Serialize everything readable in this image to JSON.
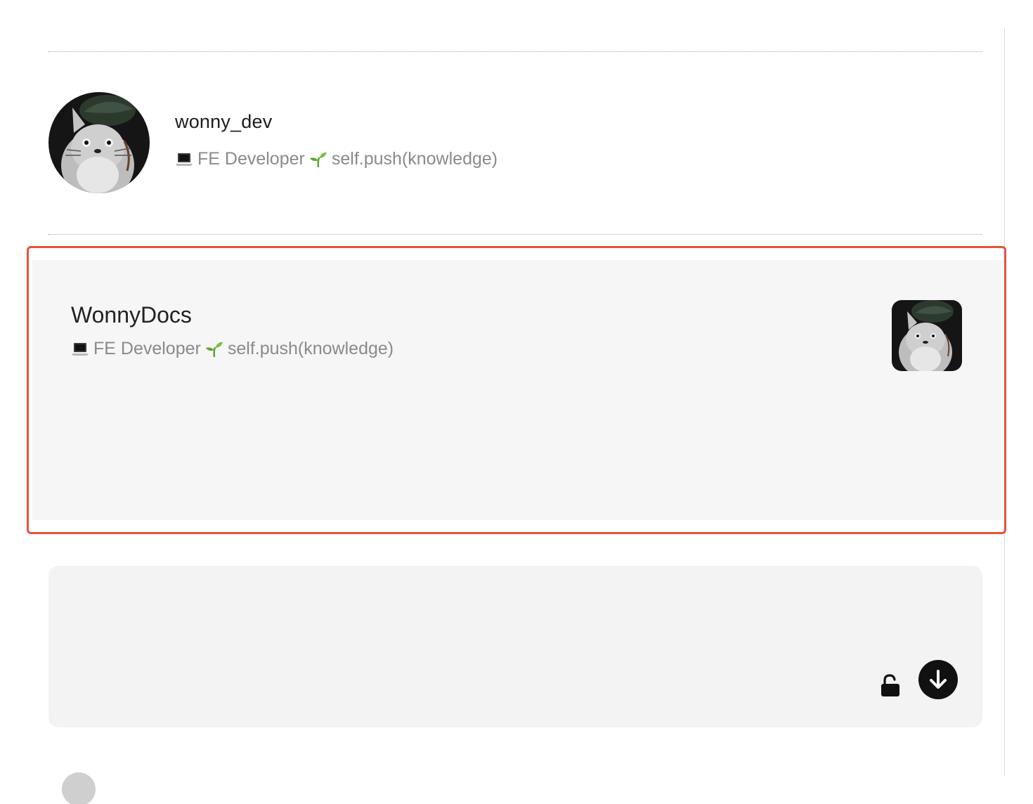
{
  "profile": {
    "name": "wonny_dev",
    "bio_text": "FE Developer",
    "bio_code": "self.push(knowledge)",
    "avatar_icon": "totoro-avatar"
  },
  "link_card": {
    "title": "WonnyDocs",
    "desc_text": "FE Developer",
    "desc_code": "self.push(knowledge)",
    "thumbnail_icon": "totoro-thumbnail",
    "highlight_color": "#e8533a"
  },
  "bottom_panel": {
    "lock_icon": "unlock-icon",
    "download_icon": "arrow-down-circle-icon"
  },
  "colors": {
    "accent": "#e8533a",
    "muted_text": "#8a8a8a",
    "card_bg": "#f6f6f6",
    "panel_bg": "#f3f3f4"
  }
}
